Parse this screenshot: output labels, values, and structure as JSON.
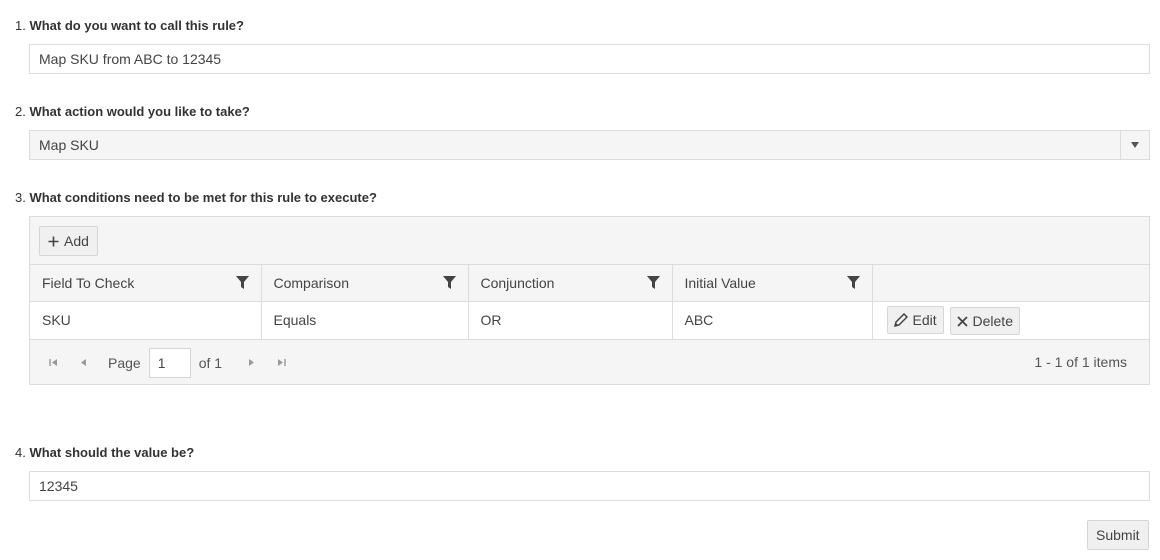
{
  "q1": {
    "num": "1.",
    "label": "What do you want to call this rule?",
    "value": "Map SKU from ABC to 12345"
  },
  "q2": {
    "num": "2.",
    "label": "What action would you like to take?",
    "value": "Map SKU"
  },
  "q3": {
    "num": "3.",
    "label": "What conditions need to be met for this rule to execute?",
    "add_label": "Add",
    "columns": [
      "Field To Check",
      "Comparison",
      "Conjunction",
      "Initial Value"
    ],
    "rows": [
      {
        "field": "SKU",
        "comparison": "Equals",
        "conjunction": "OR",
        "initial_value": "ABC"
      }
    ],
    "edit_label": "Edit",
    "delete_label": "Delete",
    "pager": {
      "page_label": "Page",
      "page": "1",
      "of_label": "of 1",
      "info": "1 - 1 of 1 items"
    }
  },
  "q4": {
    "num": "4.",
    "label": "What should the value be?",
    "value": "12345"
  },
  "submit_label": "Submit",
  "icons": {
    "add": "plus-icon",
    "filter": "filter-icon",
    "edit": "pencil-icon",
    "delete": "x-icon",
    "first": "first-page-icon",
    "prev": "prev-page-icon",
    "next": "next-page-icon",
    "last": "last-page-icon",
    "dropdown": "chevron-down-icon"
  }
}
